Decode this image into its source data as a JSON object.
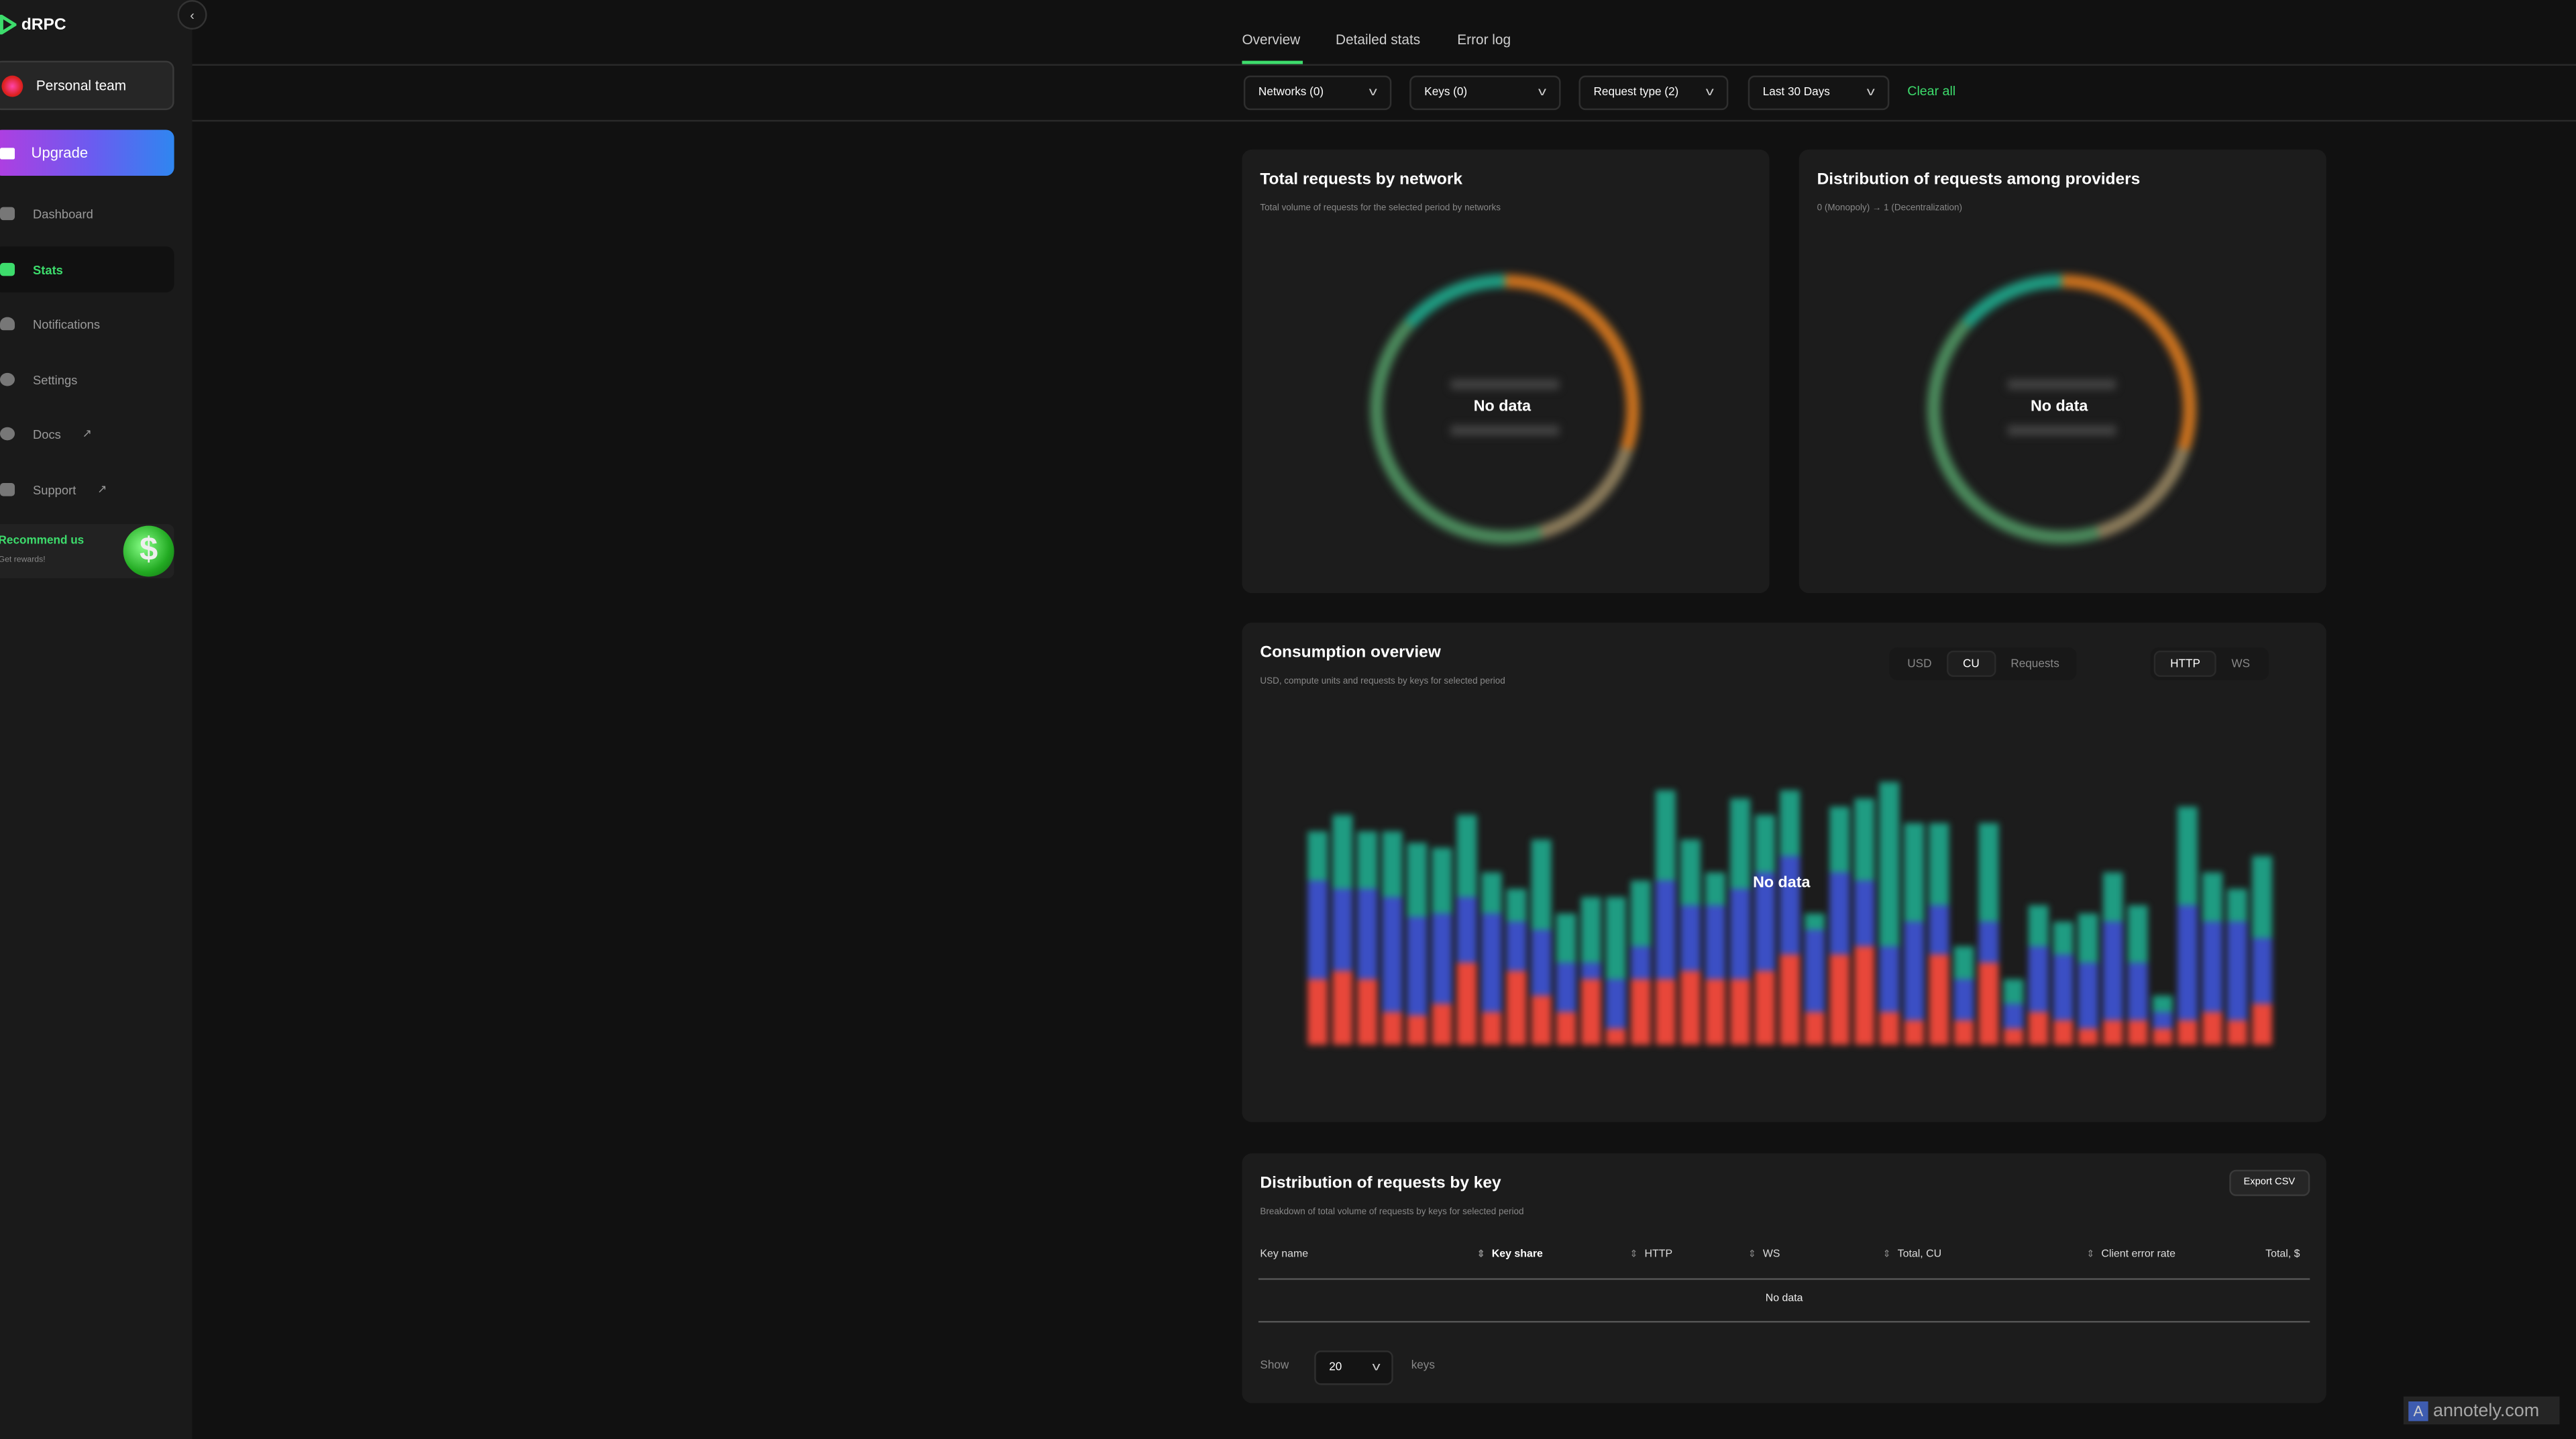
{
  "brand": {
    "name": "dRPC",
    "accent": "#3ddc6c"
  },
  "sidebar": {
    "collapse_icon": "chevron-left",
    "team": "Personal team",
    "upgrade": "Upgrade",
    "items": [
      {
        "label": "Dashboard",
        "icon": "dashboard-icon"
      },
      {
        "label": "Stats",
        "icon": "bar-chart-icon",
        "active": true
      },
      {
        "label": "Notifications",
        "icon": "bell-icon"
      },
      {
        "label": "Settings",
        "icon": "gear-icon"
      },
      {
        "label": "Docs",
        "icon": "compass-icon",
        "external": "↗"
      },
      {
        "label": "Support",
        "icon": "discord-icon",
        "external": "↗"
      }
    ],
    "recommend": {
      "title": "Recommend us",
      "subtitle": "Get rewards!"
    }
  },
  "tabs": [
    "Overview",
    "Detailed stats",
    "Error log"
  ],
  "filters": {
    "networks": "Networks (0)",
    "keys": "Keys (0)",
    "request_type": "Request type (2)",
    "period": "Last 30 Days",
    "clear": "Clear all"
  },
  "cards": {
    "network": {
      "title": "Total requests by network",
      "subtitle": "Total volume of requests for the selected period by networks",
      "empty": "No data"
    },
    "providers": {
      "title": "Distribution of requests among providers",
      "subtitle": "0 (Monopoly) → 1 (Decentralization)",
      "empty": "No data"
    },
    "consumption": {
      "title": "Consumption overview",
      "subtitle": "USD, compute units and requests by keys for selected period",
      "empty": "No data",
      "unit_toggle": [
        "USD",
        "CU",
        "Requests"
      ],
      "unit_selected": "CU",
      "proto_toggle": [
        "HTTP",
        "WS"
      ],
      "proto_selected": "HTTP",
      "placeholder_colors": {
        "red": "#e8473a",
        "blue": "#3b4fc4",
        "teal": "#1f9c82"
      },
      "placeholder_bars": [
        [
          40,
          60,
          30
        ],
        [
          45,
          50,
          45
        ],
        [
          40,
          55,
          35
        ],
        [
          20,
          70,
          40
        ],
        [
          18,
          60,
          45
        ],
        [
          25,
          55,
          40
        ],
        [
          50,
          40,
          50
        ],
        [
          20,
          60,
          25
        ],
        [
          45,
          30,
          20
        ],
        [
          30,
          40,
          55
        ],
        [
          20,
          30,
          30
        ],
        [
          40,
          10,
          40
        ],
        [
          10,
          30,
          50
        ],
        [
          40,
          20,
          40
        ],
        [
          40,
          60,
          55
        ],
        [
          45,
          40,
          40
        ],
        [
          40,
          45,
          20
        ],
        [
          40,
          55,
          55
        ],
        [
          45,
          60,
          35
        ],
        [
          55,
          60,
          40
        ],
        [
          20,
          50,
          10
        ],
        [
          55,
          50,
          40
        ],
        [
          60,
          40,
          50
        ],
        [
          20,
          40,
          100
        ],
        [
          15,
          60,
          60
        ],
        [
          55,
          30,
          50
        ],
        [
          15,
          25,
          20
        ],
        [
          50,
          25,
          60
        ],
        [
          10,
          15,
          15
        ],
        [
          20,
          40,
          25
        ],
        [
          15,
          40,
          20
        ],
        [
          10,
          40,
          30
        ],
        [
          15,
          60,
          30
        ],
        [
          15,
          35,
          35
        ],
        [
          10,
          10,
          10
        ],
        [
          15,
          70,
          60
        ],
        [
          20,
          55,
          30
        ],
        [
          15,
          60,
          20
        ],
        [
          25,
          40,
          50
        ]
      ]
    },
    "keys_table": {
      "title": "Distribution of requests by key",
      "subtitle": "Breakdown of total volume of requests by keys for selected period",
      "export": "Export CSV",
      "columns": [
        "Key name",
        "Key share",
        "HTTP",
        "WS",
        "Total, CU",
        "Client error rate",
        "Total, $"
      ],
      "empty": "No data",
      "show_label": "Show",
      "page_size": "20",
      "keys_label": "keys"
    }
  },
  "watermark": "annotely.com"
}
